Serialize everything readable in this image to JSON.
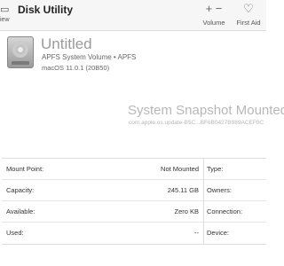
{
  "toolbar": {
    "view_label": "iew",
    "title": "Disk Utility",
    "volume_glyph": "+ −",
    "volume_label": "Volume",
    "first_aid_label": "First Aid"
  },
  "volume": {
    "name": "Untitled",
    "subtitle": "APFS System Volume • APFS",
    "os": "macOS 11.0.1 (20B50)"
  },
  "snapshot": {
    "title": "System Snapshot Mounted",
    "identifier": "com.apple.os.update-B5C...BF6B0427B989ACEF0C"
  },
  "info": {
    "rows": [
      {
        "label": "Mount Point:",
        "value": "Not Mounted",
        "right_label": "Type:"
      },
      {
        "label": "Capacity:",
        "value": "245.11 GB",
        "right_label": "Owners:"
      },
      {
        "label": "Available:",
        "value": "Zero KB",
        "right_label": "Connection:"
      },
      {
        "label": "Used:",
        "value": "--",
        "right_label": "Device:"
      }
    ]
  }
}
